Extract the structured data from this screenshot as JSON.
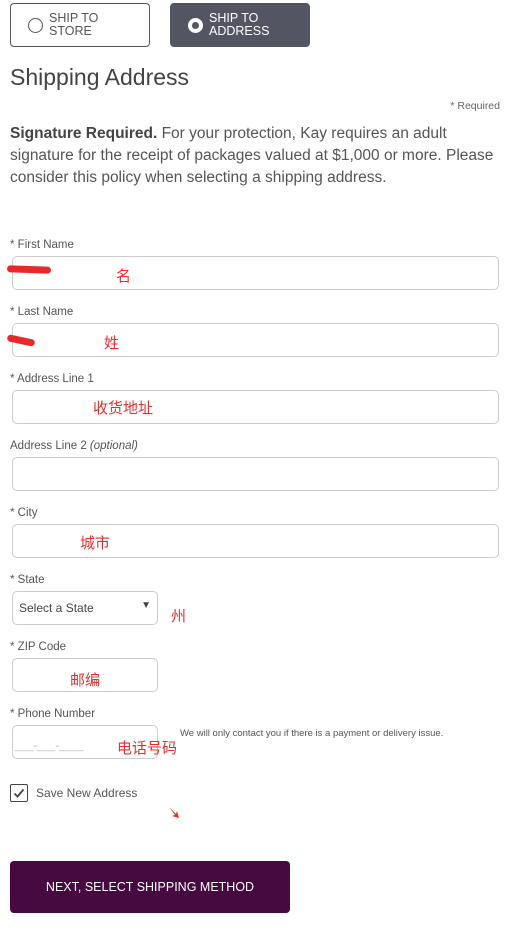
{
  "shipping_toggle": {
    "store_label": "SHIP TO\nSTORE",
    "address_label": "SHIP TO\nADDRESS",
    "selected": "address"
  },
  "page_title": "Shipping Address",
  "required_note": "* Required",
  "signature": {
    "bold": "Signature Required.",
    "text": " For your protection, Kay requires an adult signature for the receipt of packages valued at $1,000 or more. Please consider this policy when selecting a shipping address."
  },
  "fields": {
    "first_name": {
      "label": "* First Name",
      "value": "",
      "annotation": "名"
    },
    "last_name": {
      "label": "* Last Name",
      "value": "",
      "annotation": "姓"
    },
    "address1": {
      "label": "* Address Line 1",
      "value": "",
      "annotation": "收货地址"
    },
    "address2": {
      "label": "Address Line 2 ",
      "optional": "(optional)",
      "value": ""
    },
    "city": {
      "label": "* City",
      "value": "",
      "annotation": "城市"
    },
    "state": {
      "label": "* State",
      "selected": "Select a State",
      "annotation": "州"
    },
    "zip": {
      "label": "* ZIP Code",
      "value": "",
      "annotation": "邮编"
    },
    "phone": {
      "label": "* Phone Number",
      "placeholder": "___-___-____",
      "note": "We will only contact you if there is a payment or delivery issue.",
      "annotation": "电话号码"
    }
  },
  "save_address": {
    "label": "Save New Address",
    "checked": true
  },
  "next_button": "NEXT, SELECT SHIPPING METHOD",
  "colors": {
    "toggle_active": "#545563",
    "primary_button": "#460a40",
    "annotation": "#e53030"
  }
}
